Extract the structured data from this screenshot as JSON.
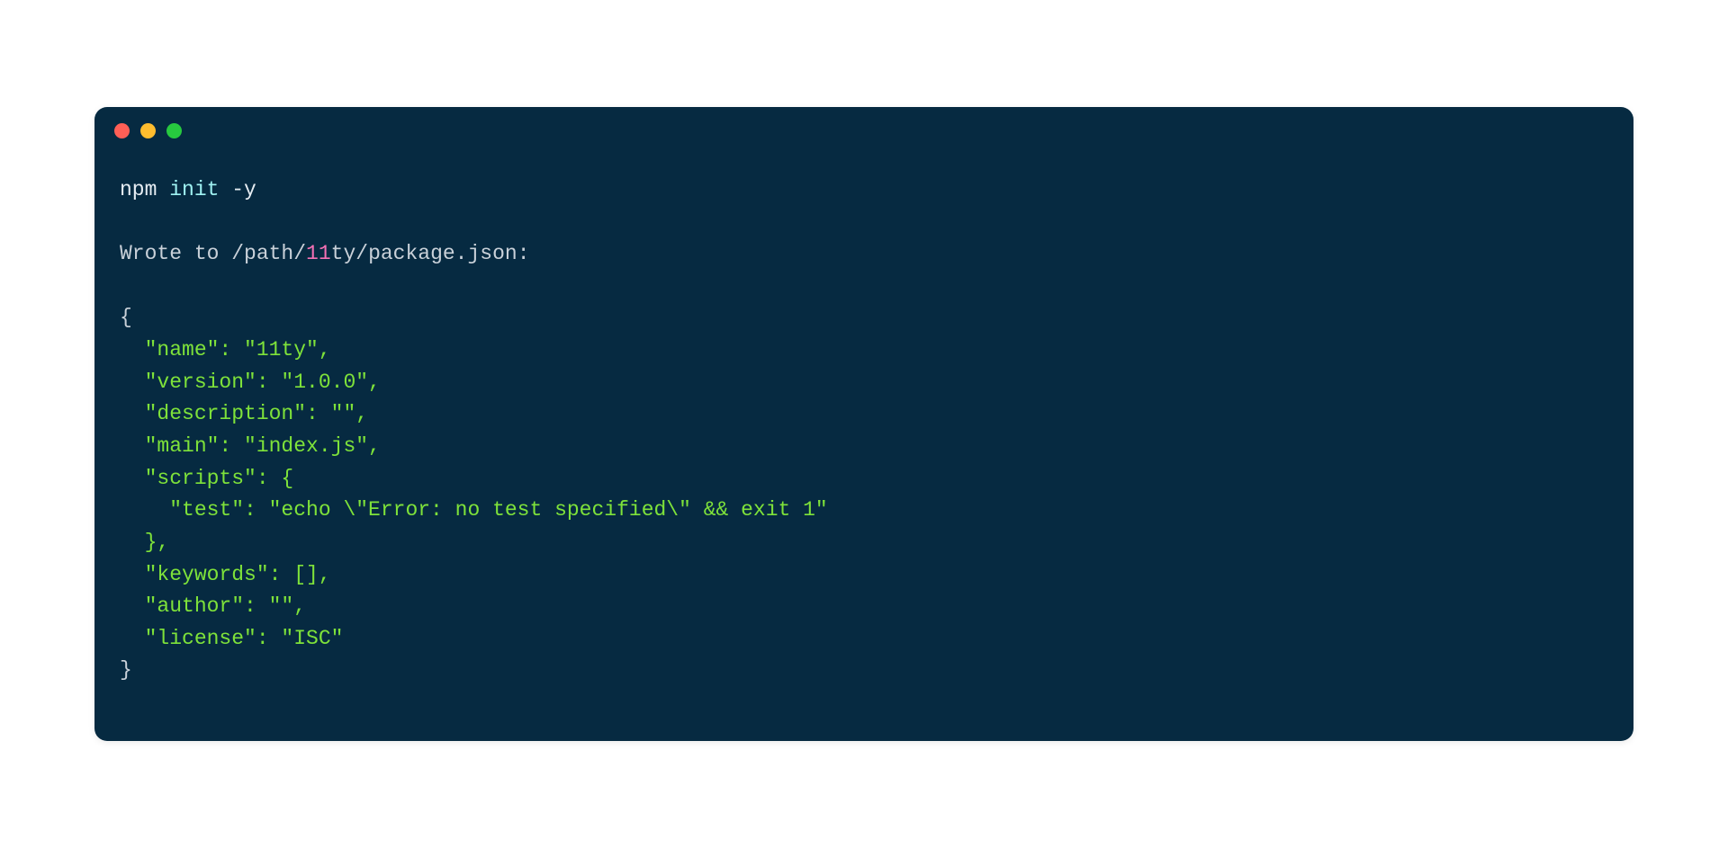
{
  "command": {
    "npm": "npm ",
    "init": "init",
    "flag": " -y"
  },
  "wrote": {
    "prefix": "Wrote to /path/",
    "number": "11",
    "suffix": "ty/package.json:"
  },
  "json": {
    "open": "{",
    "name_line": "  \"name\": \"11ty\",",
    "version_line": "  \"version\": \"1.0.0\",",
    "description_line": "  \"description\": \"\",",
    "main_line": "  \"main\": \"index.js\",",
    "scripts_open": "  \"scripts\": {",
    "test_line": "    \"test\": \"echo \\\"Error: no test specified\\\" && exit 1\"",
    "scripts_close": "  },",
    "keywords_line": "  \"keywords\": [],",
    "author_line": "  \"author\": \"\",",
    "license_line": "  \"license\": \"ISC\"",
    "close": "}"
  }
}
